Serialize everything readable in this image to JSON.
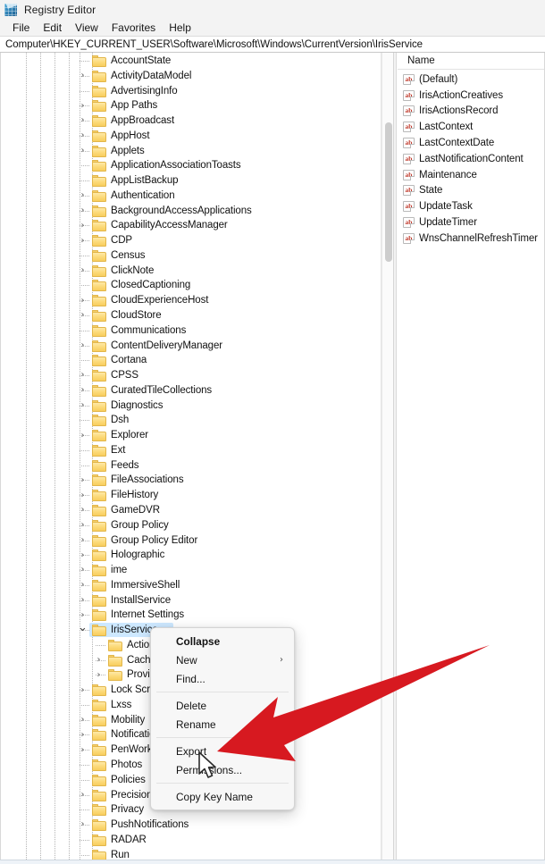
{
  "window": {
    "title": "Registry Editor",
    "icon": "registry-editor-icon"
  },
  "menubar": {
    "items": [
      {
        "label": "File"
      },
      {
        "label": "Edit"
      },
      {
        "label": "View"
      },
      {
        "label": "Favorites"
      },
      {
        "label": "Help"
      }
    ]
  },
  "address": {
    "path": "Computer\\HKEY_CURRENT_USER\\Software\\Microsoft\\Windows\\CurrentVersion\\IrisService"
  },
  "tree": {
    "selected_key": "IrisService",
    "selection_color": "#cde8ff",
    "items": [
      {
        "label": "AccountState",
        "depth": 0,
        "expandable": false,
        "expanded": false
      },
      {
        "label": "ActivityDataModel",
        "depth": 0,
        "expandable": true,
        "expanded": false
      },
      {
        "label": "AdvertisingInfo",
        "depth": 0,
        "expandable": false,
        "expanded": false
      },
      {
        "label": "App Paths",
        "depth": 0,
        "expandable": true,
        "expanded": false
      },
      {
        "label": "AppBroadcast",
        "depth": 0,
        "expandable": true,
        "expanded": false
      },
      {
        "label": "AppHost",
        "depth": 0,
        "expandable": true,
        "expanded": false
      },
      {
        "label": "Applets",
        "depth": 0,
        "expandable": true,
        "expanded": false
      },
      {
        "label": "ApplicationAssociationToasts",
        "depth": 0,
        "expandable": false,
        "expanded": false
      },
      {
        "label": "AppListBackup",
        "depth": 0,
        "expandable": false,
        "expanded": false
      },
      {
        "label": "Authentication",
        "depth": 0,
        "expandable": true,
        "expanded": false
      },
      {
        "label": "BackgroundAccessApplications",
        "depth": 0,
        "expandable": true,
        "expanded": false
      },
      {
        "label": "CapabilityAccessManager",
        "depth": 0,
        "expandable": true,
        "expanded": false
      },
      {
        "label": "CDP",
        "depth": 0,
        "expandable": true,
        "expanded": false
      },
      {
        "label": "Census",
        "depth": 0,
        "expandable": false,
        "expanded": false
      },
      {
        "label": "ClickNote",
        "depth": 0,
        "expandable": true,
        "expanded": false
      },
      {
        "label": "ClosedCaptioning",
        "depth": 0,
        "expandable": false,
        "expanded": false
      },
      {
        "label": "CloudExperienceHost",
        "depth": 0,
        "expandable": true,
        "expanded": false
      },
      {
        "label": "CloudStore",
        "depth": 0,
        "expandable": true,
        "expanded": false
      },
      {
        "label": "Communications",
        "depth": 0,
        "expandable": false,
        "expanded": false
      },
      {
        "label": "ContentDeliveryManager",
        "depth": 0,
        "expandable": true,
        "expanded": false
      },
      {
        "label": "Cortana",
        "depth": 0,
        "expandable": false,
        "expanded": false
      },
      {
        "label": "CPSS",
        "depth": 0,
        "expandable": true,
        "expanded": false
      },
      {
        "label": "CuratedTileCollections",
        "depth": 0,
        "expandable": true,
        "expanded": false
      },
      {
        "label": "Diagnostics",
        "depth": 0,
        "expandable": true,
        "expanded": false
      },
      {
        "label": "Dsh",
        "depth": 0,
        "expandable": false,
        "expanded": false
      },
      {
        "label": "Explorer",
        "depth": 0,
        "expandable": true,
        "expanded": false
      },
      {
        "label": "Ext",
        "depth": 0,
        "expandable": false,
        "expanded": false
      },
      {
        "label": "Feeds",
        "depth": 0,
        "expandable": false,
        "expanded": false
      },
      {
        "label": "FileAssociations",
        "depth": 0,
        "expandable": true,
        "expanded": false
      },
      {
        "label": "FileHistory",
        "depth": 0,
        "expandable": true,
        "expanded": false
      },
      {
        "label": "GameDVR",
        "depth": 0,
        "expandable": true,
        "expanded": false
      },
      {
        "label": "Group Policy",
        "depth": 0,
        "expandable": true,
        "expanded": false
      },
      {
        "label": "Group Policy Editor",
        "depth": 0,
        "expandable": true,
        "expanded": false
      },
      {
        "label": "Holographic",
        "depth": 0,
        "expandable": true,
        "expanded": false
      },
      {
        "label": "ime",
        "depth": 0,
        "expandable": true,
        "expanded": false
      },
      {
        "label": "ImmersiveShell",
        "depth": 0,
        "expandable": true,
        "expanded": false
      },
      {
        "label": "InstallService",
        "depth": 0,
        "expandable": true,
        "expanded": false
      },
      {
        "label": "Internet Settings",
        "depth": 0,
        "expandable": true,
        "expanded": false
      },
      {
        "label": "IrisService",
        "depth": 0,
        "expandable": true,
        "expanded": true,
        "selected": true
      },
      {
        "label": "Actions",
        "depth": 1,
        "expandable": false,
        "expanded": false
      },
      {
        "label": "Cache",
        "depth": 1,
        "expandable": true,
        "expanded": false
      },
      {
        "label": "Providers",
        "depth": 1,
        "expandable": true,
        "expanded": false
      },
      {
        "label": "Lock Screen",
        "depth": 0,
        "expandable": true,
        "expanded": false
      },
      {
        "label": "Lxss",
        "depth": 0,
        "expandable": false,
        "expanded": false
      },
      {
        "label": "Mobility",
        "depth": 0,
        "expandable": true,
        "expanded": false
      },
      {
        "label": "Notifications",
        "depth": 0,
        "expandable": true,
        "expanded": false
      },
      {
        "label": "PenWorkspace",
        "depth": 0,
        "expandable": true,
        "expanded": false
      },
      {
        "label": "Photos",
        "depth": 0,
        "expandable": false,
        "expanded": false
      },
      {
        "label": "Policies",
        "depth": 0,
        "expandable": false,
        "expanded": false
      },
      {
        "label": "Precision Touch Pad",
        "depth": 0,
        "expandable": true,
        "expanded": false
      },
      {
        "label": "Privacy",
        "depth": 0,
        "expandable": false,
        "expanded": false
      },
      {
        "label": "PushNotifications",
        "depth": 0,
        "expandable": true,
        "expanded": false
      },
      {
        "label": "RADAR",
        "depth": 0,
        "expandable": false,
        "expanded": false
      },
      {
        "label": "Run",
        "depth": 0,
        "expandable": false,
        "expanded": false
      }
    ]
  },
  "values": {
    "column_header": "Name",
    "icon_label": "ab",
    "rows": [
      {
        "name": "(Default)"
      },
      {
        "name": "IrisActionCreatives"
      },
      {
        "name": "IrisActionsRecord"
      },
      {
        "name": "LastContext"
      },
      {
        "name": "LastContextDate"
      },
      {
        "name": "LastNotificationContent"
      },
      {
        "name": "Maintenance"
      },
      {
        "name": "State"
      },
      {
        "name": "UpdateTask"
      },
      {
        "name": "UpdateTimer"
      },
      {
        "name": "WnsChannelRefreshTimer"
      }
    ]
  },
  "context_menu": {
    "items": [
      {
        "label": "Collapse",
        "bold": true,
        "submenu": false,
        "separator_after": false
      },
      {
        "label": "New",
        "bold": false,
        "submenu": true,
        "separator_after": false
      },
      {
        "label": "Find...",
        "bold": false,
        "submenu": false,
        "separator_after": true
      },
      {
        "label": "Delete",
        "bold": false,
        "submenu": false,
        "separator_after": false
      },
      {
        "label": "Rename",
        "bold": false,
        "submenu": false,
        "separator_after": true
      },
      {
        "label": "Export",
        "bold": false,
        "submenu": false,
        "separator_after": false
      },
      {
        "label": "Permissions...",
        "bold": false,
        "submenu": false,
        "separator_after": true
      },
      {
        "label": "Copy Key Name",
        "bold": false,
        "submenu": false,
        "separator_after": false
      }
    ],
    "submenu_glyph": "›"
  },
  "annotation": {
    "arrow_color": "#d71920",
    "points_to": "Export"
  }
}
